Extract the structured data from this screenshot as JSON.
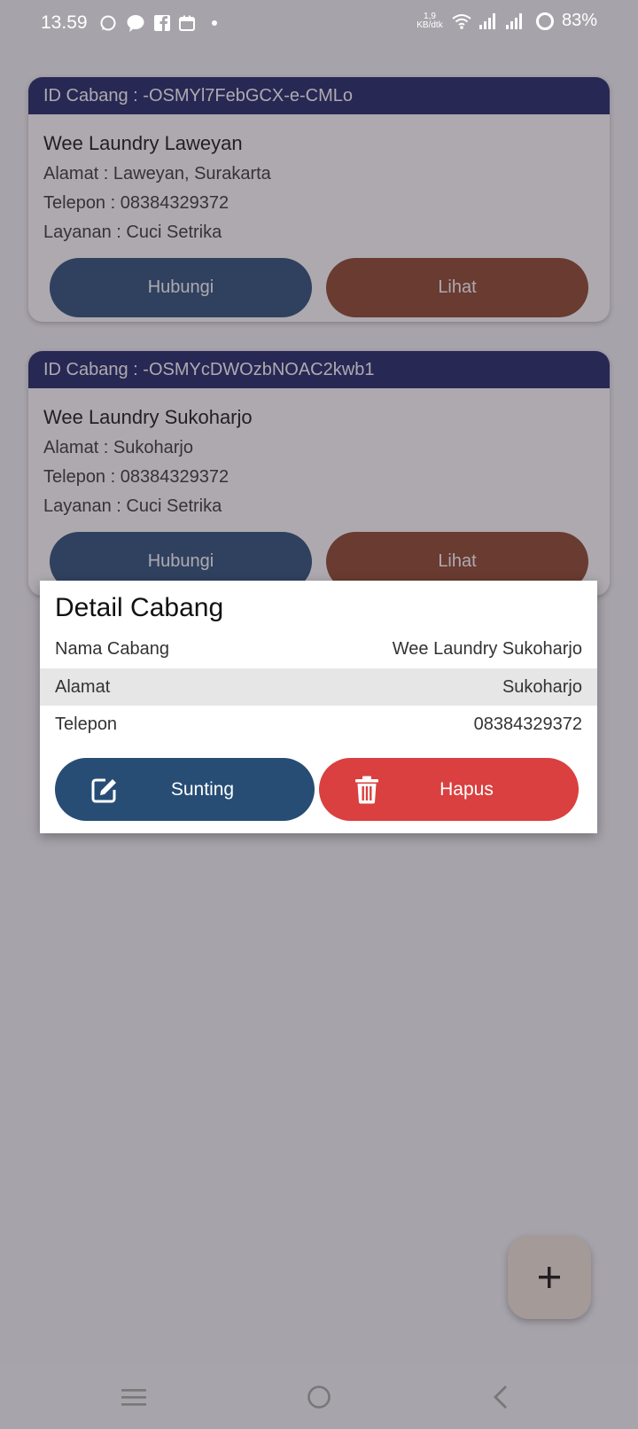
{
  "status_bar": {
    "time": "13.59",
    "net_speed_value": "1,9",
    "net_speed_unit": "KB/dtk",
    "battery": "83%",
    "notification_icons": [
      "whatsapp-icon",
      "messenger-icon",
      "facebook-icon",
      "calendar-icon",
      "dot-icon"
    ]
  },
  "branches": [
    {
      "id_line": "ID Cabang : -OSMYl7FebGCX-e-CMLo",
      "name": "Wee Laundry Laweyan",
      "address": "Alamat : Laweyan, Surakarta",
      "phone": "Telepon : 08384329372",
      "service": "Layanan : Cuci Setrika",
      "contact_label": "Hubungi",
      "view_label": "Lihat"
    },
    {
      "id_line": "ID Cabang : -OSMYcDWOzbNOAC2kwb1",
      "name": "Wee Laundry Sukoharjo",
      "address": "Alamat : Sukoharjo",
      "phone": "Telepon : 08384329372",
      "service": "Layanan : Cuci Setrika",
      "contact_label": "Hubungi",
      "view_label": "Lihat"
    }
  ],
  "dialog": {
    "title": "Detail Cabang",
    "rows": [
      {
        "label": "Nama Cabang",
        "value": "Wee Laundry Sukoharjo"
      },
      {
        "label": "Alamat",
        "value": "Sukoharjo"
      },
      {
        "label": "Telepon",
        "value": "08384329372"
      }
    ],
    "edit_label": "Sunting",
    "delete_label": "Hapus"
  },
  "fab": {
    "icon": "plus-icon",
    "label": "+"
  },
  "colors": {
    "card_header": "#1a2163",
    "contact_button": "#274d74",
    "view_button": "#8a4327",
    "edit_button": "#274d74",
    "delete_button": "#d9403f",
    "fab_bg": "#f0e6d8"
  }
}
